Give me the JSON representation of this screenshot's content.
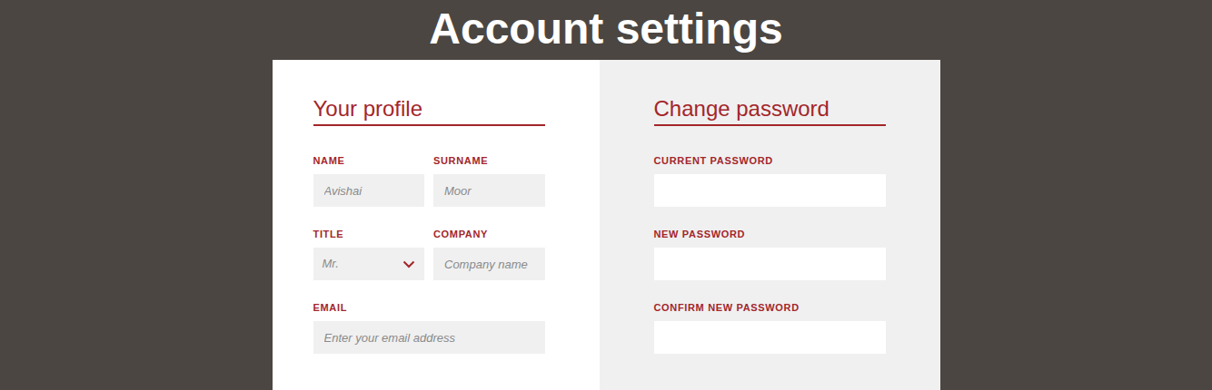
{
  "page": {
    "title": "Account settings"
  },
  "profile": {
    "heading": "Your profile",
    "rows": [
      [
        {
          "kind": "text",
          "label": "NAME",
          "placeholder": "Avishai"
        },
        {
          "kind": "text",
          "label": "SURNAME",
          "placeholder": "Moor"
        }
      ],
      [
        {
          "kind": "select",
          "label": "TITLE",
          "value": "Mr."
        },
        {
          "kind": "text",
          "label": "COMPANY",
          "placeholder": "Company name"
        }
      ],
      [
        {
          "kind": "text",
          "label": "EMAIL",
          "placeholder": "Enter your email address"
        }
      ]
    ]
  },
  "password": {
    "heading": "Change password",
    "fields": [
      {
        "label": "CURRENT PASSWORD"
      },
      {
        "label": "NEW PASSWORD"
      },
      {
        "label": "CONFIRM NEW PASSWORD"
      }
    ]
  }
}
